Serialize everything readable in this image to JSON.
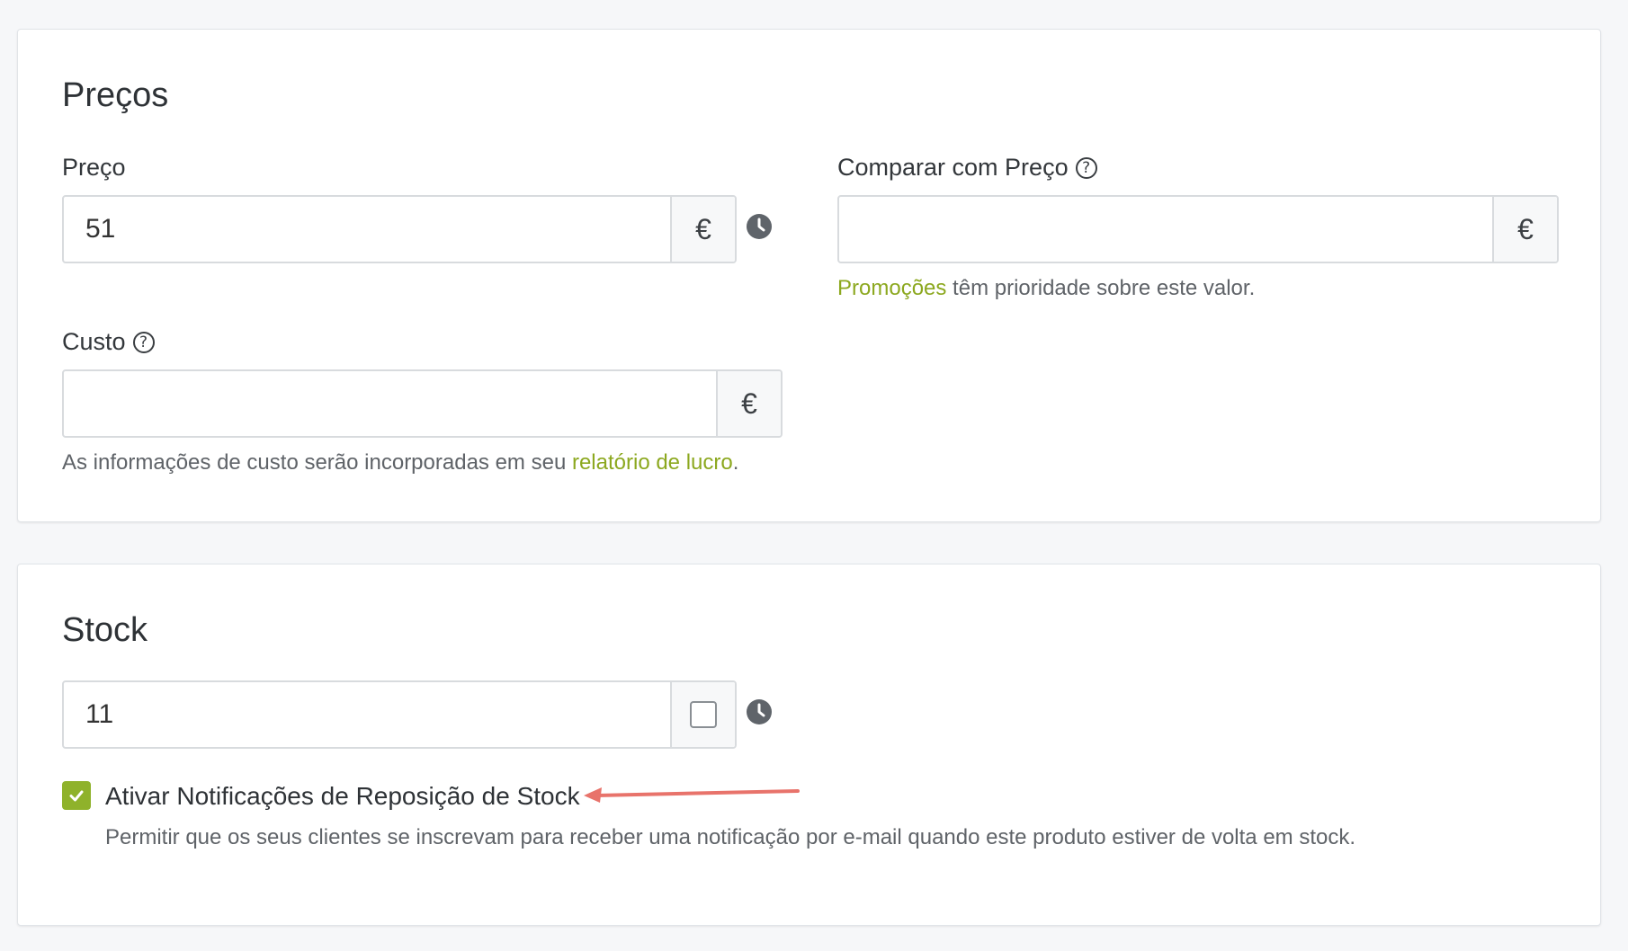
{
  "prices": {
    "title": "Preços",
    "price": {
      "label": "Preço",
      "value": "51",
      "currency": "€",
      "icon": "clock-icon"
    },
    "compare": {
      "label": "Comparar com Preço",
      "value": "",
      "currency": "€",
      "help_icon": "question-circle-icon",
      "note_link": "Promoções",
      "note_text": " têm prioridade sobre este valor."
    },
    "cost": {
      "label": "Custo",
      "value": "",
      "currency": "€",
      "help_icon": "question-circle-icon",
      "note_text": "As informações de custo serão incorporadas em seu ",
      "note_link": "relatório de lucro",
      "note_end": "."
    }
  },
  "stock": {
    "title": "Stock",
    "quantity": "11",
    "unlimited_checked": false,
    "restock": {
      "checked": true,
      "label": "Ativar Notificações de Reposição de Stock",
      "description": "Permitir que os seus clientes se inscrevam para receber uma notificação por e-mail quando este produto estiver de volta em stock."
    }
  },
  "colors": {
    "accent": "#8ca81f",
    "checkbox": "#8fb22b",
    "annotation_arrow": "#e8736b"
  }
}
